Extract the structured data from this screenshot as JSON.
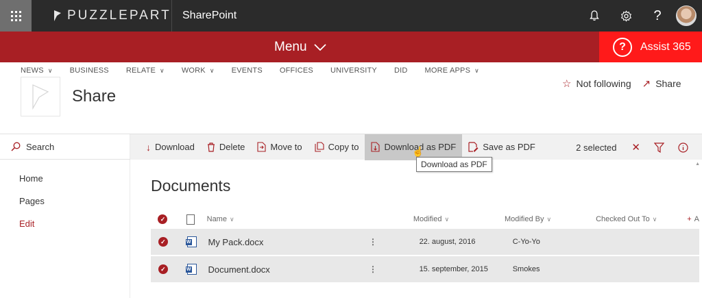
{
  "suite": {
    "brand": "PUZZLEPART",
    "app_name": "SharePoint",
    "icons": [
      "bell-icon",
      "gear-icon",
      "help-icon",
      "avatar"
    ]
  },
  "menu": {
    "label": "Menu"
  },
  "assist": {
    "label": "Assist 365",
    "icon": "?"
  },
  "global_nav": [
    {
      "label": "NEWS",
      "dropdown": true
    },
    {
      "label": "BUSINESS",
      "dropdown": false
    },
    {
      "label": "RELATE",
      "dropdown": true
    },
    {
      "label": "WORK",
      "dropdown": true
    },
    {
      "label": "EVENTS",
      "dropdown": false
    },
    {
      "label": "OFFICES",
      "dropdown": false
    },
    {
      "label": "UNIVERSITY",
      "dropdown": false
    },
    {
      "label": "DID",
      "dropdown": false
    },
    {
      "label": "MORE APPS",
      "dropdown": true
    }
  ],
  "site": {
    "title": "Share",
    "follow_label": "Not following",
    "share_label": "Share"
  },
  "search": {
    "label": "Search"
  },
  "quick_nav": [
    {
      "label": "Home",
      "active": false
    },
    {
      "label": "Pages",
      "active": false
    },
    {
      "label": "Edit",
      "active": true
    }
  ],
  "commands": {
    "download": "Download",
    "delete": "Delete",
    "move_to": "Move to",
    "copy_to": "Copy to",
    "download_pdf": "Download as PDF",
    "save_pdf": "Save as PDF",
    "selected": "2 selected"
  },
  "tooltip": "Download as PDF",
  "library": {
    "title": "Documents",
    "columns": {
      "name": "Name",
      "modified": "Modified",
      "modified_by": "Modified By",
      "checked_out_to": "Checked Out To",
      "add": "A"
    },
    "rows": [
      {
        "name": "My Pack.docx",
        "modified": "22. august, 2016",
        "modified_by": "C-Yo-Yo"
      },
      {
        "name": "Document.docx",
        "modified": "15. september, 2015",
        "modified_by": "Smokes"
      }
    ]
  },
  "colors": {
    "accent": "#a81f24",
    "assist": "#ff1a1a",
    "suite_bg": "#2b2b2b"
  }
}
